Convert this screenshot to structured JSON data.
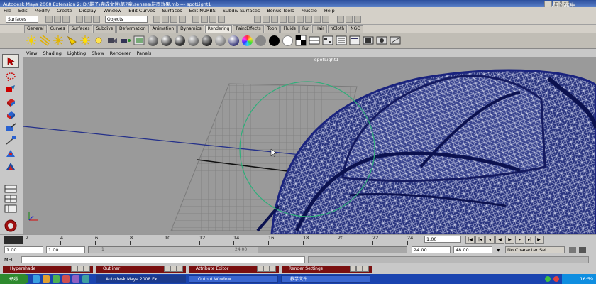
{
  "window": {
    "title": "Autodesk Maya 2008 Extension 2: D:\\鞋子\\完成文件\\第7章\\senses\\鞋面效果.mb   ---   spotLight1",
    "watermark": "优酷"
  },
  "menus": [
    "File",
    "Edit",
    "Modify",
    "Create",
    "Display",
    "Window",
    "Edit Curves",
    "Surfaces",
    "Edit NURBS",
    "Subdiv Surfaces",
    "Bonus Tools",
    "Muscle",
    "Help"
  ],
  "statusline": {
    "mode": "Surfaces",
    "selection_mode": "Objects"
  },
  "shelf": {
    "tabs": [
      "General",
      "Curves",
      "Surfaces",
      "Subdivs",
      "Deformation",
      "Animation",
      "Dynamics",
      "Rendering",
      "PaintEffects",
      "Toon",
      "Fluids",
      "Fur",
      "Hair",
      "nCloth",
      "NGC"
    ],
    "active_tab": "Rendering"
  },
  "viewport": {
    "menus": [
      "View",
      "Shading",
      "Lighting",
      "Show",
      "Renderer",
      "Panels"
    ],
    "camera": "spotLight1"
  },
  "timeline": {
    "ticks": [
      "2",
      "4",
      "6",
      "8",
      "10",
      "12",
      "14",
      "16",
      "18",
      "20",
      "22",
      "24"
    ],
    "current_frame": "1.00",
    "range_start": "1.00",
    "range_inner_start": "1.00",
    "range_bar_start": "1",
    "range_bar_end": "24.00",
    "range_end": "24.00",
    "anim_end": "48.00",
    "character_set": "No Character Set"
  },
  "cmdline": {
    "label": "MEL"
  },
  "minimized_panels": [
    "Hypershade",
    "Outliner",
    "Attribute Editor",
    "Render Settings"
  ],
  "taskbar": {
    "start": "开始",
    "tasks": [
      "Autodesk Maya 2008 Ext...",
      "Output Window",
      "教学文件"
    ],
    "clock": "16:59"
  },
  "colors": {
    "wire": "#1a237e",
    "viewport_bg": "#9a9a9a",
    "title_bar": "#2c4f9e",
    "minimized_panel": "#7a1010"
  }
}
